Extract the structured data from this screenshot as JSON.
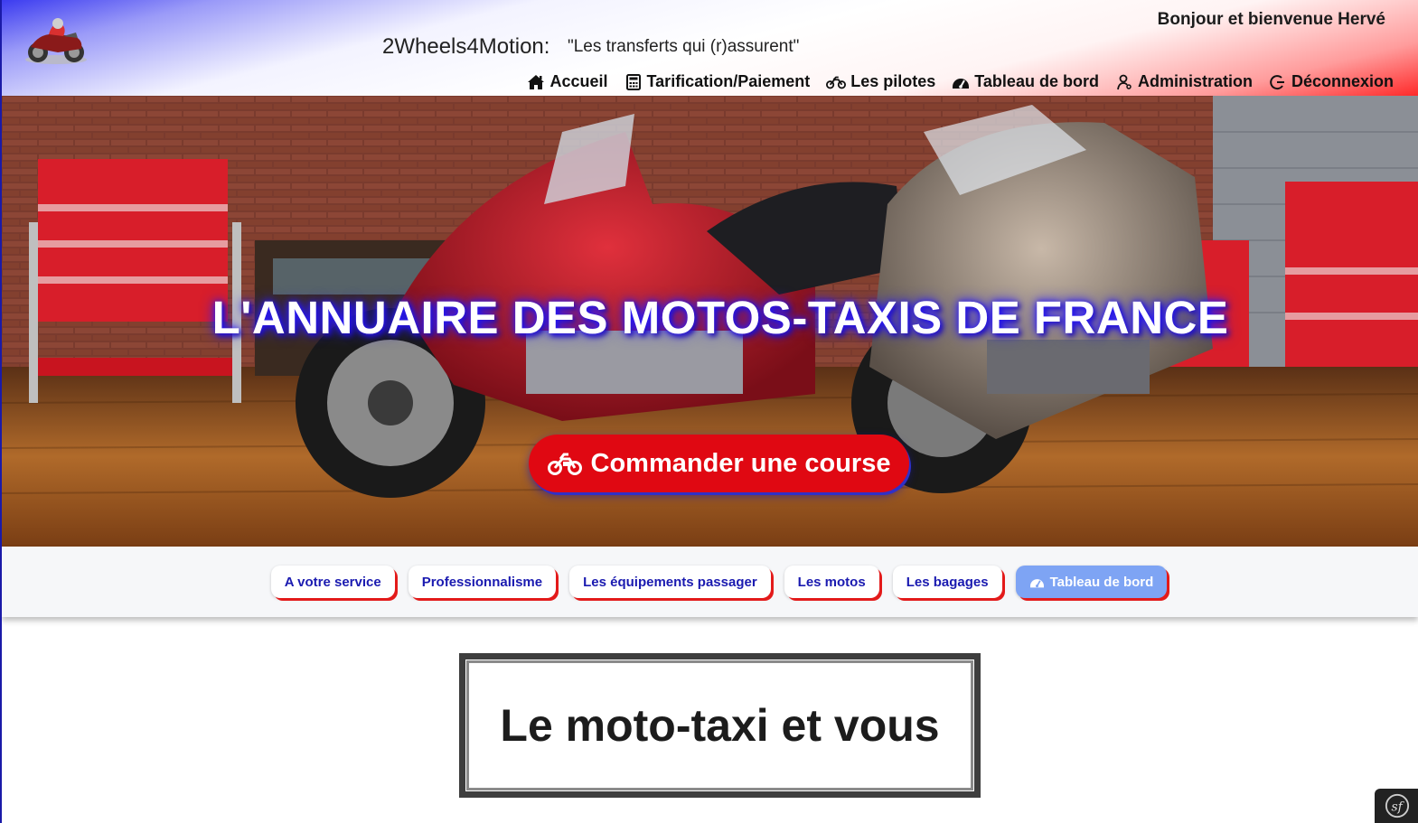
{
  "header": {
    "brand": "2Wheels4Motion:",
    "tagline": "\"Les transferts qui (r)assurent\"",
    "greeting": "Bonjour et bienvenue Hervé",
    "nav": [
      {
        "label": "Accueil",
        "icon": "home-icon"
      },
      {
        "label": "Tarification/Paiement",
        "icon": "calculator-icon"
      },
      {
        "label": "Les pilotes",
        "icon": "motorcycle-icon"
      },
      {
        "label": "Tableau de bord",
        "icon": "dashboard-icon"
      },
      {
        "label": "Administration",
        "icon": "user-admin-icon"
      },
      {
        "label": "Déconnexion",
        "icon": "logout-icon"
      }
    ]
  },
  "hero": {
    "title": "L'ANNUAIRE DES MOTOS-TAXIS DE FRANCE",
    "cta_label": "Commander une course",
    "cta_icon": "motorcycle-icon"
  },
  "subnav": {
    "items": [
      {
        "label": "A votre service",
        "active": false
      },
      {
        "label": "Professionnalisme",
        "active": false
      },
      {
        "label": "Les équipements passager",
        "active": false
      },
      {
        "label": "Les motos",
        "active": false
      },
      {
        "label": "Les bagages",
        "active": false
      },
      {
        "label": "Tableau de bord",
        "active": true,
        "icon": "dashboard-icon"
      }
    ]
  },
  "main": {
    "section_title": "Le moto-taxi et vous"
  },
  "colors": {
    "accent_red": "#e00812",
    "link_blue": "#1a1ab0",
    "active_pill": "#7ea4f4"
  }
}
